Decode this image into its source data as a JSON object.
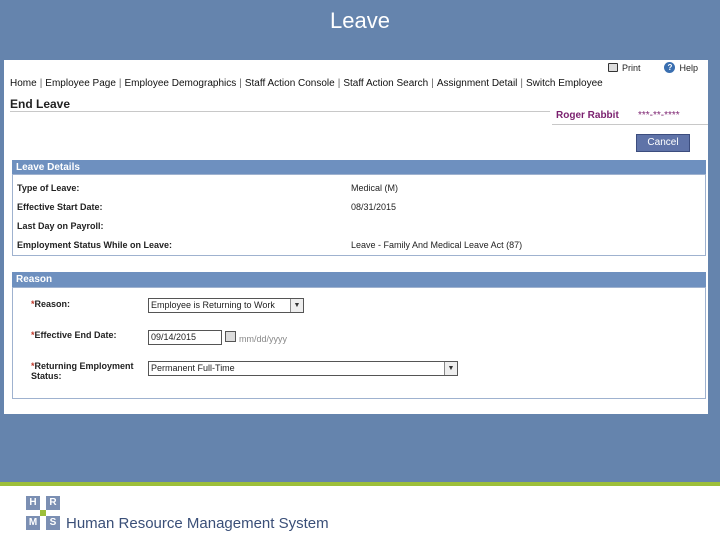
{
  "slide": {
    "title": "Leave"
  },
  "utility": {
    "print_label": "Print",
    "help_label": "Help"
  },
  "nav": [
    "Home",
    "Employee Page",
    "Employee Demographics",
    "Staff Action Console",
    "Staff Action Search",
    "Assignment Detail",
    "Switch Employee"
  ],
  "page": {
    "title": "End Leave",
    "employee_name": "Roger Rabbit",
    "employee_id": "***-**-****",
    "cancel_label": "Cancel"
  },
  "leave_details": {
    "header": "Leave Details",
    "rows": [
      {
        "label": "Type of Leave:",
        "value": "Medical (M)"
      },
      {
        "label": "Effective Start Date:",
        "value": "08/31/2015"
      },
      {
        "label": "Last Day on Payroll:",
        "value": ""
      },
      {
        "label": "Employment Status While on Leave:",
        "value": "Leave - Family And Medical Leave Act (87)"
      }
    ]
  },
  "reason": {
    "header": "Reason",
    "required_marker": "*",
    "reason_label": "Reason:",
    "reason_value": "Employee is Returning to Work",
    "end_date_label": "Effective End Date:",
    "end_date_value": "09/14/2015",
    "date_hint": "mm/dd/yyyy",
    "status_label_line1": "Returning Employment",
    "status_label_line2": "Status:",
    "status_value": "Permanent Full-Time"
  },
  "footer": {
    "logo_letters": [
      "H",
      "R",
      "M",
      "S"
    ],
    "system_name": "Human Resource Management System"
  },
  "colors": {
    "frame_blue": "#6584ad",
    "accent_green": "#9dbf3a",
    "section_header": "#6e90bf",
    "employee_name": "#7a1f6e",
    "button": "#5f73a8"
  }
}
